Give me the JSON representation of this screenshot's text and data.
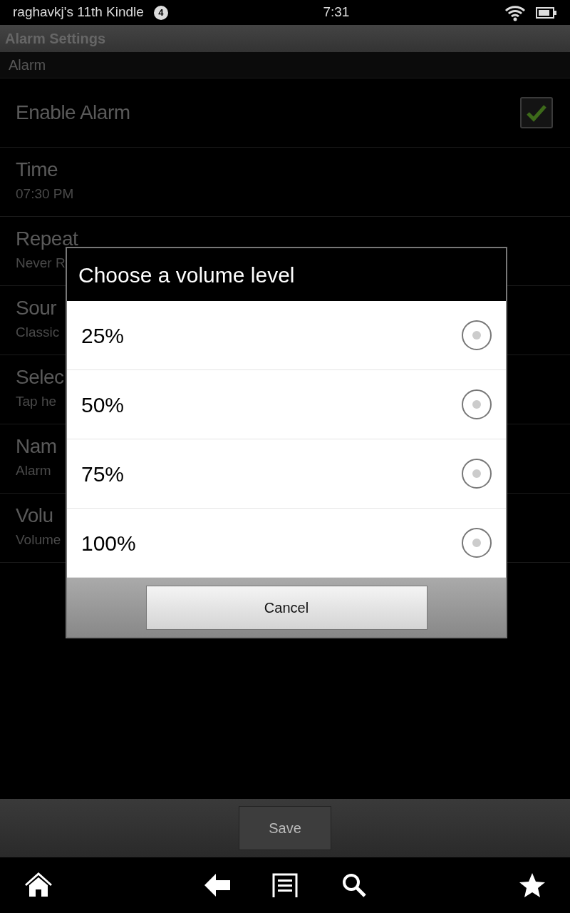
{
  "status_bar": {
    "device": "raghavkj's 11th Kindle",
    "notifications": "4",
    "time": "7:31"
  },
  "title_bar": {
    "title": "Alarm Settings"
  },
  "section": {
    "title": "Alarm"
  },
  "settings": [
    {
      "kind": "checkbox",
      "title": "Enable Alarm",
      "checked": true
    },
    {
      "kind": "text",
      "title": "Time",
      "subtitle": "07:30 PM"
    },
    {
      "kind": "text",
      "title": "Repeat",
      "subtitle": "Never R"
    },
    {
      "kind": "text",
      "title": "Sour",
      "subtitle": "Classic"
    },
    {
      "kind": "text",
      "title": "Selec",
      "subtitle": "Tap he"
    },
    {
      "kind": "text",
      "title": "Nam",
      "subtitle": "Alarm"
    },
    {
      "kind": "text",
      "title": "Volu",
      "subtitle": "Volume"
    }
  ],
  "dialog": {
    "title": "Choose a volume level",
    "options": [
      {
        "label": "25%",
        "selected": false
      },
      {
        "label": "50%",
        "selected": false
      },
      {
        "label": "75%",
        "selected": false
      },
      {
        "label": "100%",
        "selected": false
      }
    ],
    "cancel": "Cancel"
  },
  "action_bar": {
    "save": "Save"
  }
}
